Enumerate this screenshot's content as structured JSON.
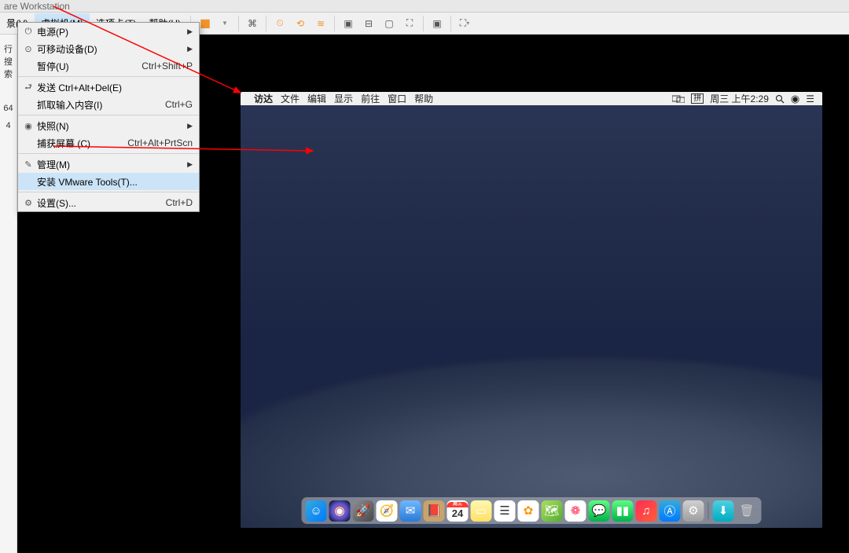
{
  "app": {
    "title": "are Workstation"
  },
  "menubar": {
    "items": [
      {
        "label": "景(V)"
      },
      {
        "label": "虚拟机(M)"
      },
      {
        "label": "选项卡(T)"
      },
      {
        "label": "帮助(H)"
      }
    ]
  },
  "sidebar": {
    "search": "行搜索",
    "entries": [
      "64",
      "4"
    ]
  },
  "dropdown": {
    "items": [
      {
        "icon": "⏻",
        "label": "电源(P)",
        "shortcut": "",
        "submenu": true
      },
      {
        "icon": "⊙",
        "label": "可移动设备(D)",
        "shortcut": "",
        "submenu": true
      },
      {
        "icon": "",
        "label": "暂停(U)",
        "shortcut": "Ctrl+Shift+P",
        "submenu": false
      },
      {
        "sep": true
      },
      {
        "icon": "⮐",
        "label": "发送 Ctrl+Alt+Del(E)",
        "shortcut": "",
        "submenu": false
      },
      {
        "icon": "",
        "label": "抓取输入内容(I)",
        "shortcut": "Ctrl+G",
        "submenu": false
      },
      {
        "sep": true
      },
      {
        "icon": "◉",
        "label": "快照(N)",
        "shortcut": "",
        "submenu": true
      },
      {
        "icon": "",
        "label": "捕获屏幕 (C)",
        "shortcut": "Ctrl+Alt+PrtScn",
        "submenu": false
      },
      {
        "sep": true
      },
      {
        "icon": "✎",
        "label": "管理(M)",
        "shortcut": "",
        "submenu": true
      },
      {
        "icon": "",
        "label": "安装 VMware Tools(T)...",
        "shortcut": "",
        "submenu": false,
        "highlighted": true
      },
      {
        "sep": true
      },
      {
        "icon": "⚙",
        "label": "设置(S)...",
        "shortcut": "Ctrl+D",
        "submenu": false
      }
    ]
  },
  "mac": {
    "menubar": {
      "left": [
        "访达",
        "文件",
        "编辑",
        "显示",
        "前往",
        "窗口",
        "帮助"
      ],
      "input_indicator": "拼",
      "datetime": "周三 上午2:29"
    },
    "dock": [
      {
        "name": "finder",
        "bg": "linear-gradient(135deg,#34aadc,#007aff)",
        "glyph": "☺"
      },
      {
        "name": "siri",
        "bg": "radial-gradient(circle,#ff5e3a,#5856d6,#000)",
        "glyph": "◉"
      },
      {
        "name": "launchpad",
        "bg": "linear-gradient(135deg,#8e8e93,#48484a)",
        "glyph": "🚀"
      },
      {
        "name": "safari",
        "bg": "#fff",
        "glyph": "🧭"
      },
      {
        "name": "mail",
        "bg": "linear-gradient(#6fb7ff,#2a7ad6)",
        "glyph": "✉"
      },
      {
        "name": "contacts",
        "bg": "#c9a36a",
        "glyph": "📕"
      },
      {
        "name": "calendar",
        "bg": "#fff",
        "glyph": "24",
        "text_color": "#333"
      },
      {
        "name": "notes",
        "bg": "linear-gradient(#fff8b0,#ffe066)",
        "glyph": "▭"
      },
      {
        "name": "reminders",
        "bg": "#fff",
        "glyph": "☰",
        "text_color": "#333"
      },
      {
        "name": "photos",
        "bg": "#fff",
        "glyph": "✿",
        "text_color": "#ff9500"
      },
      {
        "name": "maps",
        "bg": "linear-gradient(135deg,#a8e063,#56ab2f)",
        "glyph": "🗺"
      },
      {
        "name": "photos2",
        "bg": "#fff",
        "glyph": "❁",
        "text_color": "#ff2d55"
      },
      {
        "name": "messages",
        "bg": "linear-gradient(#5efc82,#00b248)",
        "glyph": "💬"
      },
      {
        "name": "facetime",
        "bg": "linear-gradient(#5efc82,#00b248)",
        "glyph": "▮▮"
      },
      {
        "name": "itunes",
        "bg": "linear-gradient(135deg,#ff2d55,#ff5e3a)",
        "glyph": "♫"
      },
      {
        "name": "appstore",
        "bg": "linear-gradient(#34aadc,#007aff)",
        "glyph": "Ⓐ"
      },
      {
        "name": "settings",
        "bg": "linear-gradient(#d0d0d0,#9e9e9e)",
        "glyph": "⚙"
      },
      {
        "sep": true
      },
      {
        "name": "downloads",
        "bg": "linear-gradient(#4dd0e1,#00acc1)",
        "glyph": "⬇"
      },
      {
        "name": "trash",
        "bg": "transparent",
        "glyph": "🗑",
        "text_color": "#ccc"
      }
    ]
  }
}
